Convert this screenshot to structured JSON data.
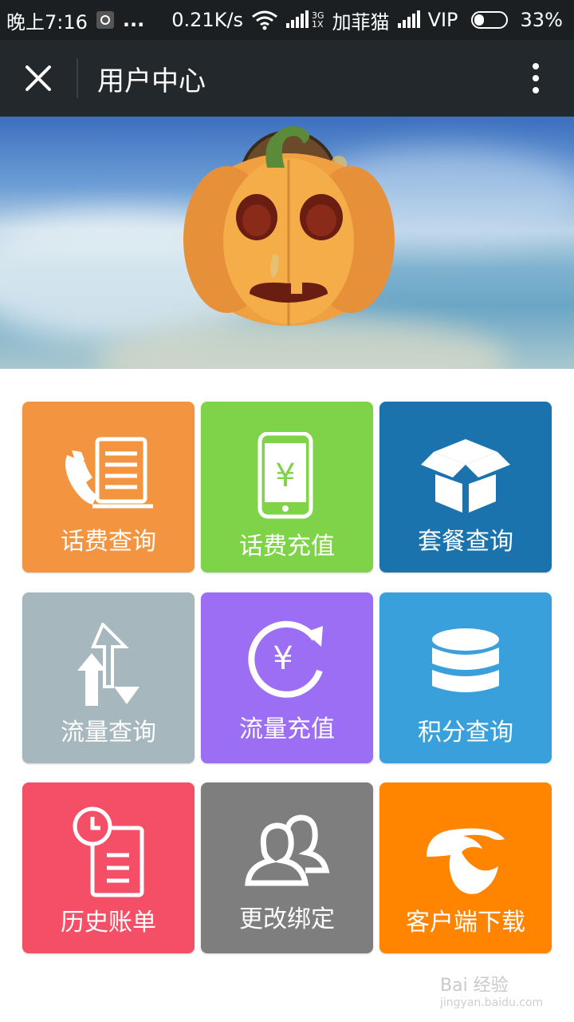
{
  "status_bar": {
    "time": "晚上7:16",
    "dots": "...",
    "speed": "0.21K/s",
    "network_label_top": "3G",
    "network_label_bottom": "1X",
    "carrier": "加菲猫",
    "vip": "VIP",
    "battery": "33%"
  },
  "toolbar": {
    "title": "用户中心"
  },
  "banner": {
    "avatar_icon": "pumpkin-avatar"
  },
  "tiles": [
    {
      "label": "话费查询",
      "icon": "phone-bill-icon",
      "color": "#f39440"
    },
    {
      "label": "话费充值",
      "icon": "phone-yuan-icon",
      "color": "#7ed348"
    },
    {
      "label": "套餐查询",
      "icon": "package-box-icon",
      "color": "#1a73ad"
    },
    {
      "label": "流量查询",
      "icon": "traffic-arrows-icon",
      "color": "#a7b7be"
    },
    {
      "label": "流量充值",
      "icon": "yuan-refresh-icon",
      "color": "#9b6ef3"
    },
    {
      "label": "积分查询",
      "icon": "database-icon",
      "color": "#3aa0db"
    },
    {
      "label": "历史账单",
      "icon": "history-bill-icon",
      "color": "#f44f66"
    },
    {
      "label": "更改绑定",
      "icon": "users-icon",
      "color": "#7e7e7e"
    },
    {
      "label": "客户端下载",
      "icon": "telecom-logo-icon",
      "color": "#ff8400"
    }
  ],
  "watermark": {
    "brand": "Bai 经验",
    "url": "jingyan.baidu.com"
  }
}
